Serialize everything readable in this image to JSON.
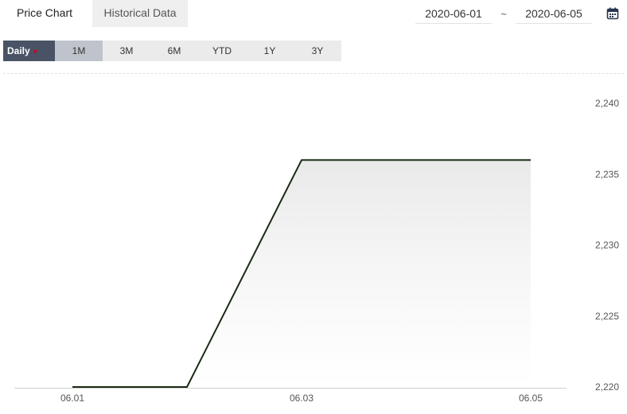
{
  "tabs": [
    {
      "label": "Price Chart"
    },
    {
      "label": "Historical Data"
    }
  ],
  "date_range": {
    "start": "2020-06-01",
    "separator": "~",
    "end": "2020-06-05"
  },
  "periods": {
    "daily": "Daily",
    "items": [
      "1M",
      "3M",
      "6M",
      "YTD",
      "1Y",
      "3Y"
    ],
    "selected": "1M"
  },
  "icons": {
    "calendar": "calendar-icon",
    "dropdown": "caret-down-icon"
  },
  "colors": {
    "line": "#1a2a14",
    "daily_bg": "#4a5366",
    "selected_bg": "#bfc3cb",
    "caret": "#d0021b"
  },
  "chart_data": {
    "type": "area",
    "x": [
      "2020-06-01",
      "2020-06-02",
      "2020-06-03",
      "2020-06-04",
      "2020-06-05"
    ],
    "series": [
      {
        "values": [
          2220,
          2220,
          2236,
          2236,
          2236
        ]
      }
    ],
    "xticks": [
      "06.01",
      "06.03",
      "06.05"
    ],
    "yticks": [
      "2,220",
      "2,225",
      "2,230",
      "2,235",
      "2,240"
    ],
    "ylim": [
      2220,
      2240
    ],
    "y_axis_position": "right",
    "grid": false
  }
}
